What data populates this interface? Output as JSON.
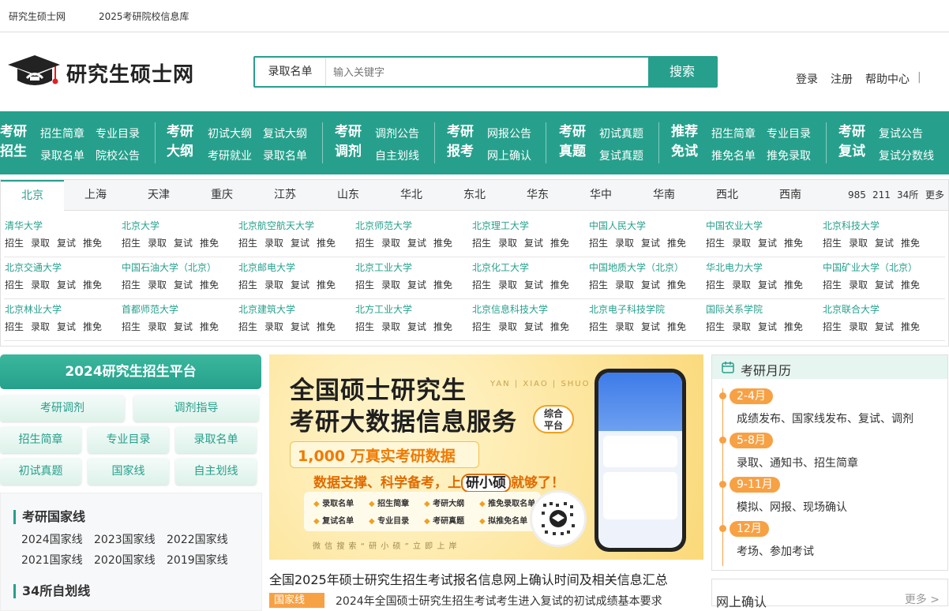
{
  "topbar": {
    "site": "研究生硕士网",
    "db": "2025考研院校信息库"
  },
  "logo": {
    "text": "研究生硕士网"
  },
  "search": {
    "category": "录取名单",
    "placeholder": "输入关键字",
    "button": "搜索"
  },
  "toplinks": {
    "login": "登录",
    "register": "注册",
    "help": "帮助中心",
    "sep": "|"
  },
  "nav": [
    {
      "title1": "考研",
      "title2": "招生",
      "links": [
        "招生简章",
        "专业目录",
        "录取名单",
        "院校公告"
      ]
    },
    {
      "title1": "考研",
      "title2": "大纲",
      "links": [
        "初试大纲",
        "复试大纲",
        "考研就业",
        "录取名单"
      ]
    },
    {
      "title1": "考研",
      "title2": "调剂",
      "links": [
        "调剂公告",
        "自主划线"
      ]
    },
    {
      "title1": "考研",
      "title2": "报考",
      "links": [
        "网报公告",
        "网上确认"
      ]
    },
    {
      "title1": "考研",
      "title2": "真题",
      "links": [
        "初试真题",
        "复试真题"
      ]
    },
    {
      "title1": "推荐",
      "title2": "免试",
      "links": [
        "招生简章",
        "专业目录",
        "推免名单",
        "推免录取"
      ]
    },
    {
      "title1": "考研",
      "title2": "复试",
      "links": [
        "复试公告",
        "复试分数线"
      ]
    }
  ],
  "cities": [
    "北京",
    "上海",
    "天津",
    "重庆",
    "江苏",
    "山东",
    "华北",
    "东北",
    "华东",
    "华中",
    "华南",
    "西北",
    "西南"
  ],
  "city_right": [
    "985",
    "211",
    "34所",
    "更多"
  ],
  "uni_actions": [
    "招生",
    "录取",
    "复试",
    "推免"
  ],
  "universities": [
    [
      "清华大学",
      "北京大学",
      "北京航空航天大学",
      "北京师范大学",
      "北京理工大学",
      "中国人民大学",
      "中国农业大学",
      "北京科技大学"
    ],
    [
      "北京交通大学",
      "中国石油大学（北京）",
      "北京邮电大学",
      "北京工业大学",
      "北京化工大学",
      "中国地质大学（北京）",
      "华北电力大学",
      "中国矿业大学（北京）"
    ],
    [
      "北京林业大学",
      "首都师范大学",
      "北京建筑大学",
      "北方工业大学",
      "北京信息科技大学",
      "北京电子科技学院",
      "国际关系学院",
      "北京联合大学"
    ]
  ],
  "platform": {
    "title": "2024研究生招生平台",
    "buttons_row1": [
      "考研调剂",
      "调剂指导"
    ],
    "buttons": [
      "招生简章",
      "专业目录",
      "录取名单",
      "初试真题",
      "国家线",
      "自主划线"
    ]
  },
  "national_line": {
    "title": "考研国家线",
    "links": [
      "2024国家线",
      "2023国家线",
      "2022国家线",
      "2021国家线",
      "2020国家线",
      "2019国家线"
    ]
  },
  "self_line": {
    "title": "34所自划线"
  },
  "banner": {
    "line1": "全国硕士研究生",
    "line2": "考研大数据信息服务",
    "badge": "综合平台",
    "pinyin": "YAN | XIAO | SHUO",
    "stat": "1,000 万真实考研数据",
    "slogan_pre": "数据支撑、科学备考，上",
    "slogan_key": "研小硕",
    "slogan_post": "就够了！",
    "features": [
      "录取名单",
      "招生简章",
      "考研大纲",
      "推免录取名单",
      "复试名单",
      "专业目录",
      "考研真题",
      "拟推免名单"
    ],
    "footer": "微 信 搜 索 “ 研 小 硕 ” 立 即 上 岸"
  },
  "headline": "全国2025年硕士研究生招生考试报名信息网上确认时间及相关信息汇总",
  "news": {
    "tag": "国家线",
    "text": "2024年全国硕士研究生招生考试考生进入复试的初试成绩基本要求"
  },
  "calendar": {
    "title": "考研月历",
    "items": [
      {
        "month": "2-4月",
        "desc": "成绩发布、国家线发布、复试、调剂"
      },
      {
        "month": "5-8月",
        "desc": "录取、通知书、招生简章"
      },
      {
        "month": "9-11月",
        "desc": "模拟、网报、现场确认"
      },
      {
        "month": "12月",
        "desc": "考场、参加考试"
      }
    ]
  },
  "online_confirm": {
    "title": "网上确认",
    "more": "更多 >"
  },
  "colors": {
    "accent": "#26a08c",
    "orange": "#f7a145"
  }
}
